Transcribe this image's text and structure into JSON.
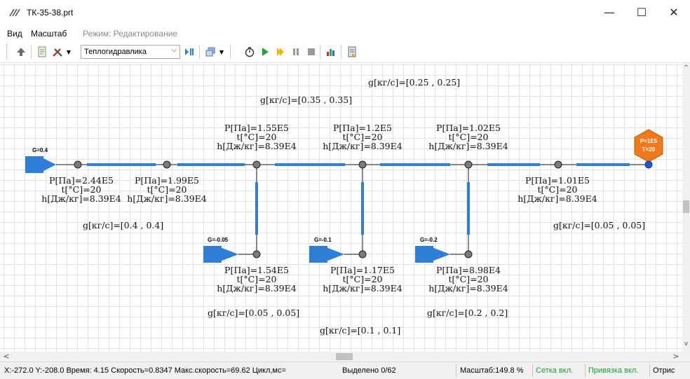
{
  "window": {
    "title": "ТК-35-38.prt",
    "minimize": "—",
    "maximize": "☐",
    "close": "✕"
  },
  "menu": {
    "view": "Вид",
    "scale": "Масштаб",
    "mode": "Режим: Редактирование"
  },
  "toolbar": {
    "mode_select": "Теплогидравлика"
  },
  "colors": {
    "pipe": "#2f7fd6",
    "source": "#2f7fd6",
    "boundary_fill": "#f07a1b",
    "boundary_dot": "#2155c9",
    "node_fill": "#7a7a7a",
    "status_green": "#1b9e2e"
  },
  "diagram": {
    "main_source_flow": "G=0.4",
    "boundary": {
      "p": "P=1E5",
      "t": "T=20"
    },
    "branch_sources": {
      "b1": "G=-0.05",
      "b2": "G=-0.1",
      "b3": "G=-0.2"
    },
    "node_labels": {
      "n1": {
        "p": "P[Па]=2.44E5",
        "t": "t[°C]=20",
        "h": "h[Дж/кг]=8.39E4"
      },
      "n2": {
        "p": "P[Па]=1.99E5",
        "t": "t[°C]=20",
        "h": "h[Дж/кг]=8.39E4"
      },
      "n3": {
        "p": "P[Па]=1.55E5",
        "t": "t[°C]=20",
        "h": "h[Дж/кг]=8.39E4"
      },
      "n4": {
        "p": "P[Па]=1.2E5",
        "t": "t[°C]=20",
        "h": "h[Дж/кг]=8.39E4"
      },
      "n5": {
        "p": "P[Па]=1.02E5",
        "t": "t[°C]=20",
        "h": "h[Дж/кг]=8.39E4"
      },
      "n6": {
        "p": "P[Па]=1.01E5",
        "t": "t[°C]=20",
        "h": "h[Дж/кг]=8.39E4"
      },
      "b1": {
        "p": "P[Па]=1.54E5",
        "t": "t[°C]=20",
        "h": "h[Дж/кг]=8.39E4"
      },
      "b2": {
        "p": "P[Па]=1.17E5",
        "t": "t[°C]=20",
        "h": "h[Дж/кг]=8.39E4"
      },
      "b3": {
        "p": "P[Па]=8.98E4",
        "t": "t[°C]=20",
        "h": "h[Дж/кг]=8.39E4"
      }
    },
    "flows": {
      "main1": "g[кг/с]=[0.4 , 0.4]",
      "main3": "g[кг/с]=[0.35 , 0.35]",
      "main4": "g[кг/с]=[0.25 , 0.25]",
      "main6": "g[кг/с]=[0.05 , 0.05]",
      "branch1": "g[кг/с]=[0.05 , 0.05]",
      "branch2": "g[кг/с]=[0.1 , 0.1]",
      "branch3": "g[кг/с]=[0.2 , 0.2]"
    }
  },
  "scroll": {
    "up": "^",
    "down": "v",
    "left": "<",
    "right": ">"
  },
  "status": {
    "coords": "X:-272.0  Y:-208.0 Время: 4.15 Скорость=0.8347 Макс.скорость=69.62 Цикл,мс=",
    "selected": "Выделено 0/62",
    "scale": "Масштаб:149.8 %",
    "grid": "Сетка вкл.",
    "snap": "Привязка вкл.",
    "render": "Отрис"
  }
}
